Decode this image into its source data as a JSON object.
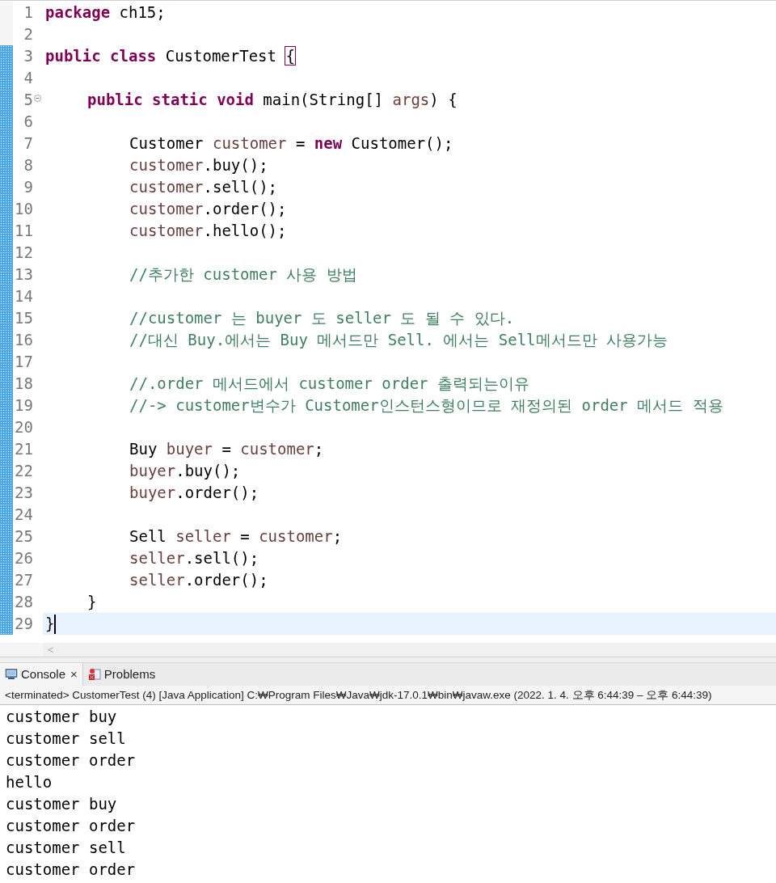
{
  "editor": {
    "lines": [
      {
        "number": "1",
        "segments": [
          {
            "kind": "keyword",
            "text": "package"
          },
          {
            "kind": "plain",
            "text": " ch15;"
          }
        ]
      },
      {
        "number": "2"
      },
      {
        "number": "3",
        "changed": true,
        "segments": [
          {
            "kind": "keyword",
            "text": "public class"
          },
          {
            "kind": "plain",
            "text": " CustomerTest "
          },
          {
            "kind": "bracket",
            "text": "{"
          }
        ]
      },
      {
        "number": "4",
        "changed": true
      },
      {
        "number": "5",
        "changed": true,
        "foldable": true,
        "segments": [
          {
            "kind": "keyword",
            "text": "\tpublic static void"
          },
          {
            "kind": "plain",
            "text": " main(String[] "
          },
          {
            "kind": "variable",
            "text": "args"
          },
          {
            "kind": "plain",
            "text": ") {"
          }
        ]
      },
      {
        "number": "6",
        "changed": true
      },
      {
        "number": "7",
        "changed": true,
        "segments": [
          {
            "kind": "plain",
            "text": "\t\tCustomer "
          },
          {
            "kind": "variable",
            "text": "customer"
          },
          {
            "kind": "plain",
            "text": " = "
          },
          {
            "kind": "keyword",
            "text": "new"
          },
          {
            "kind": "plain",
            "text": " Customer();"
          }
        ]
      },
      {
        "number": "8",
        "changed": true,
        "segments": [
          {
            "kind": "variable",
            "text": "\t\tcustomer"
          },
          {
            "kind": "plain",
            "text": ".buy();"
          }
        ]
      },
      {
        "number": "9",
        "changed": true,
        "segments": [
          {
            "kind": "variable",
            "text": "\t\tcustomer"
          },
          {
            "kind": "plain",
            "text": ".sell();"
          }
        ]
      },
      {
        "number": "10",
        "changed": true,
        "segments": [
          {
            "kind": "variable",
            "text": "\t\tcustomer"
          },
          {
            "kind": "plain",
            "text": ".order();"
          }
        ]
      },
      {
        "number": "11",
        "changed": true,
        "segments": [
          {
            "kind": "variable",
            "text": "\t\tcustomer"
          },
          {
            "kind": "plain",
            "text": ".hello();"
          }
        ]
      },
      {
        "number": "12",
        "changed": true
      },
      {
        "number": "13",
        "changed": true,
        "segments": [
          {
            "kind": "comment",
            "text": "\t\t//추가한 customer 사용 방법"
          }
        ]
      },
      {
        "number": "14",
        "changed": true
      },
      {
        "number": "15",
        "changed": true,
        "segments": [
          {
            "kind": "comment",
            "text": "\t\t//customer 는 buyer 도 seller 도 될 수 있다."
          }
        ]
      },
      {
        "number": "16",
        "changed": true,
        "segments": [
          {
            "kind": "comment",
            "text": "\t\t//대신 Buy.에서는 Buy 메서드만 Sell. 에서는 Sell메서드만 사용가능"
          }
        ]
      },
      {
        "number": "17",
        "changed": true
      },
      {
        "number": "18",
        "changed": true,
        "segments": [
          {
            "kind": "comment",
            "text": "\t\t//.order 메서드에서 customer order 출력되는이유"
          }
        ]
      },
      {
        "number": "19",
        "changed": true,
        "segments": [
          {
            "kind": "comment",
            "text": "\t\t//-> customer변수가 Customer인스턴스형이므로 재정의된 order 메서드 적용"
          }
        ]
      },
      {
        "number": "20",
        "changed": true
      },
      {
        "number": "21",
        "changed": true,
        "segments": [
          {
            "kind": "plain",
            "text": "\t\tBuy "
          },
          {
            "kind": "variable",
            "text": "buyer"
          },
          {
            "kind": "plain",
            "text": " = "
          },
          {
            "kind": "variable",
            "text": "customer"
          },
          {
            "kind": "plain",
            "text": ";"
          }
        ]
      },
      {
        "number": "22",
        "changed": true,
        "segments": [
          {
            "kind": "variable",
            "text": "\t\tbuyer"
          },
          {
            "kind": "plain",
            "text": ".buy();"
          }
        ]
      },
      {
        "number": "23",
        "changed": true,
        "segments": [
          {
            "kind": "variable",
            "text": "\t\tbuyer"
          },
          {
            "kind": "plain",
            "text": ".order();"
          }
        ]
      },
      {
        "number": "24",
        "changed": true
      },
      {
        "number": "25",
        "changed": true,
        "segments": [
          {
            "kind": "plain",
            "text": "\t\tSell "
          },
          {
            "kind": "variable",
            "text": "seller"
          },
          {
            "kind": "plain",
            "text": " = "
          },
          {
            "kind": "variable",
            "text": "customer"
          },
          {
            "kind": "plain",
            "text": ";"
          }
        ]
      },
      {
        "number": "26",
        "changed": true,
        "segments": [
          {
            "kind": "variable",
            "text": "\t\tseller"
          },
          {
            "kind": "plain",
            "text": ".sell();"
          }
        ]
      },
      {
        "number": "27",
        "changed": true,
        "segments": [
          {
            "kind": "variable",
            "text": "\t\tseller"
          },
          {
            "kind": "plain",
            "text": ".order();"
          }
        ]
      },
      {
        "number": "28",
        "changed": true,
        "segments": [
          {
            "kind": "plain",
            "text": "\t}"
          }
        ]
      },
      {
        "number": "29",
        "changed": true,
        "current": true,
        "segments": [
          {
            "kind": "plain",
            "text": "}"
          }
        ]
      }
    ],
    "scroll_left": "<"
  },
  "tabs": [
    {
      "label": "Console",
      "selected": true,
      "close": "×"
    },
    {
      "label": "Problems",
      "selected": false
    }
  ],
  "console": {
    "status": "<terminated> CustomerTest (4) [Java Application] C:₩Program Files₩Java₩jdk-17.0.1₩bin₩javaw.exe  (2022. 1. 4. 오후 6:44:39 – 오후 6:44:39)",
    "output": [
      "customer buy",
      "customer sell",
      "customer order",
      "hello",
      "customer buy",
      "customer order",
      "customer sell",
      "customer order"
    ]
  }
}
